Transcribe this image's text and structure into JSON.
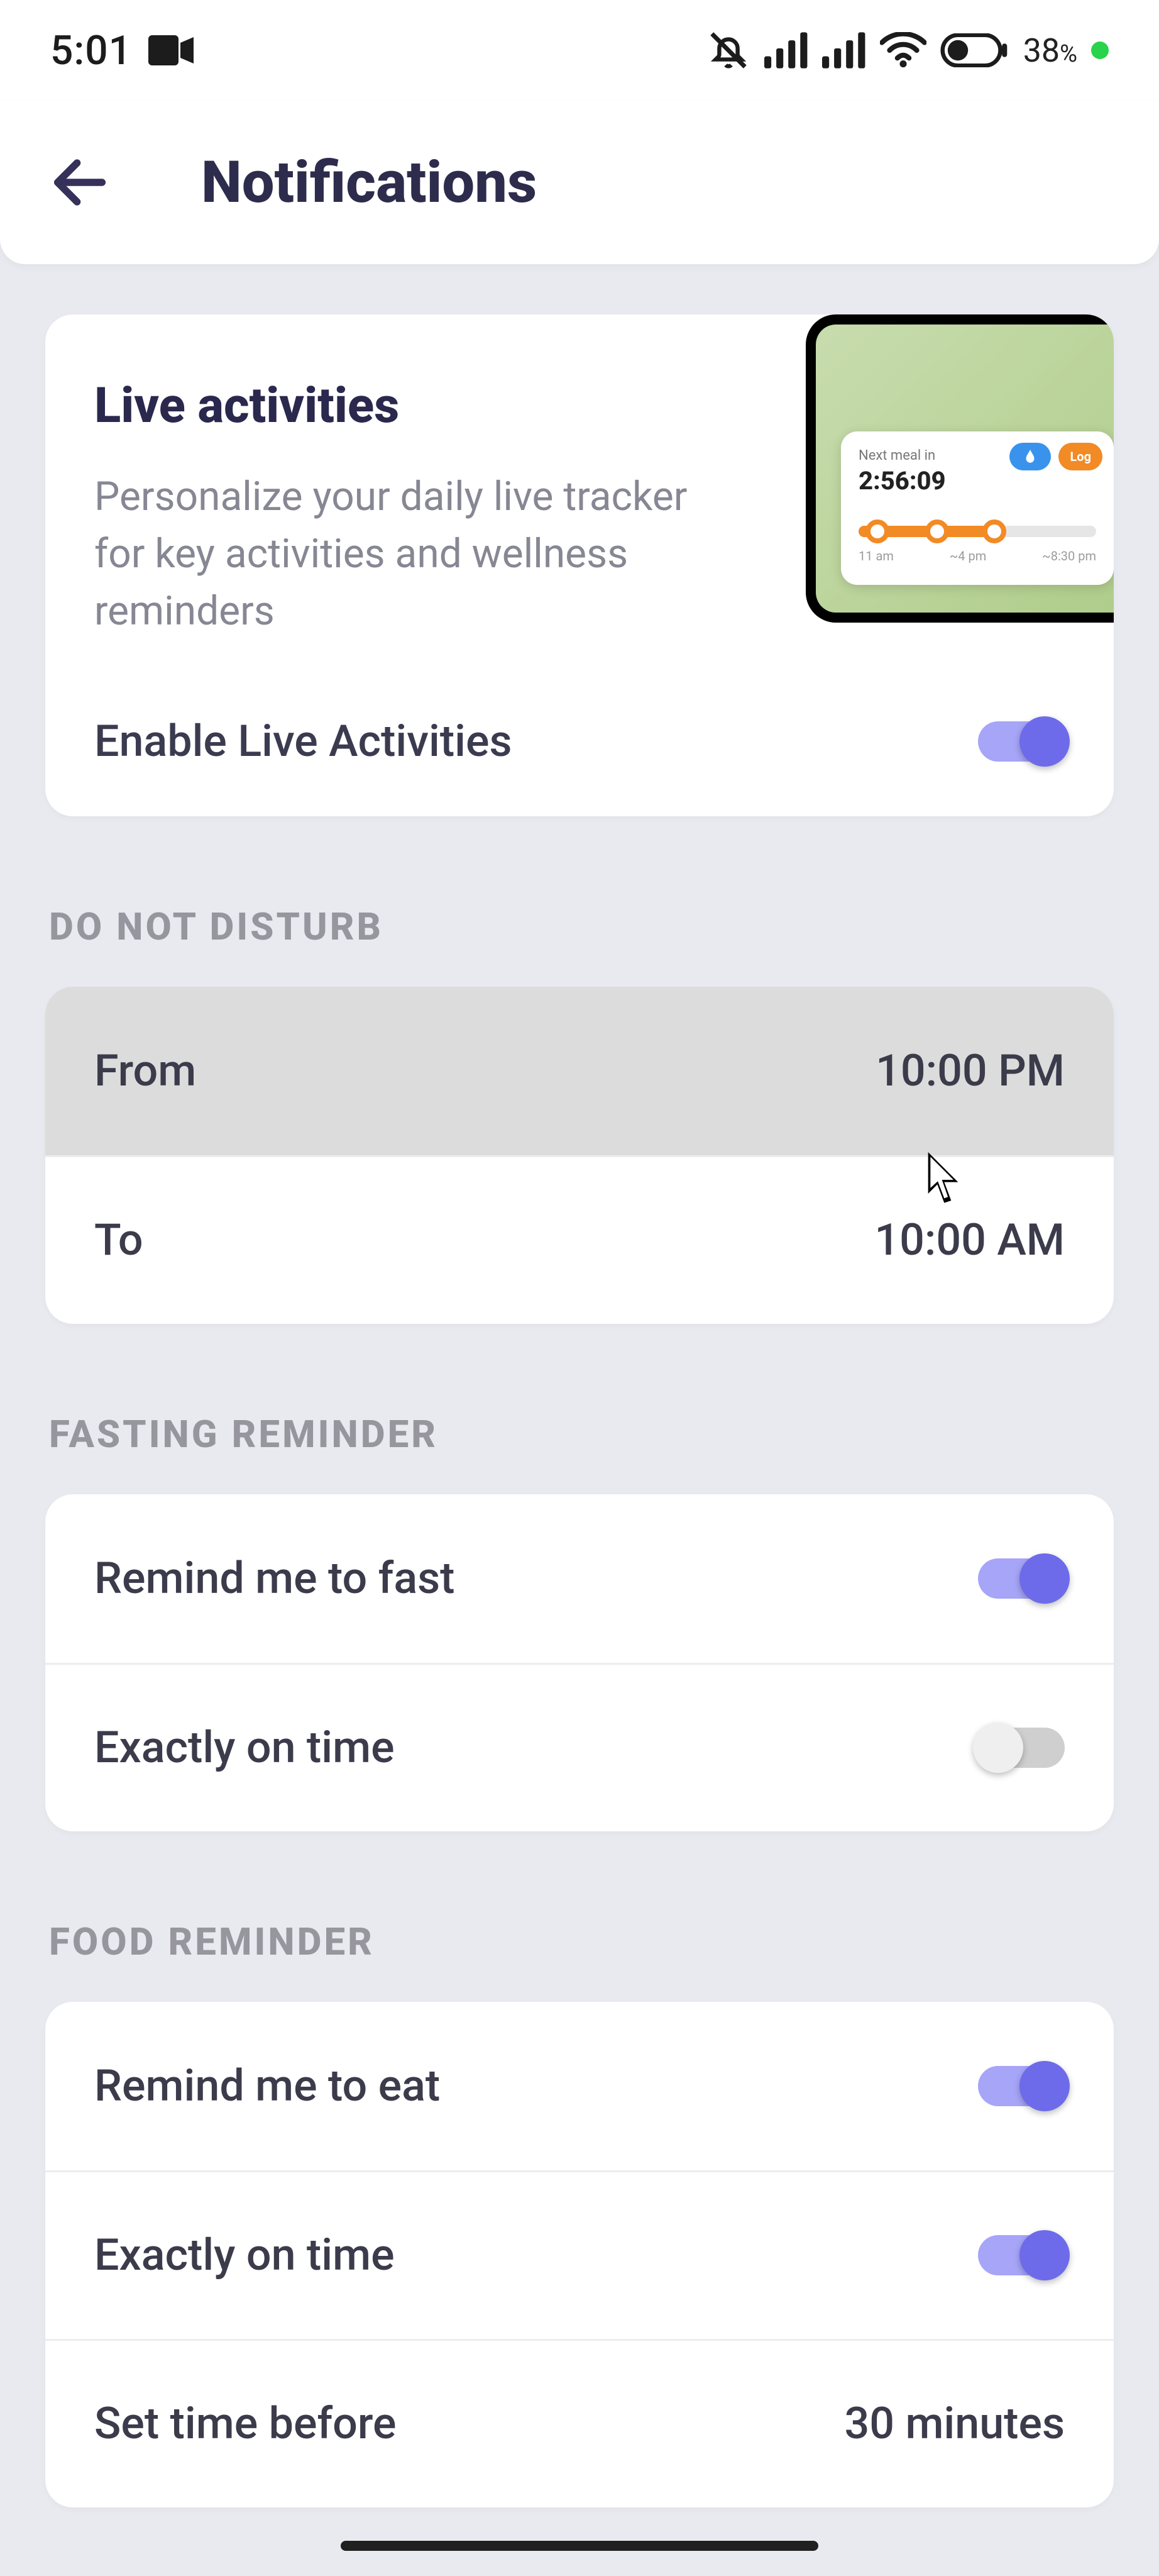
{
  "status_bar": {
    "time": "5:01",
    "battery_pct": "38",
    "pct_symbol": "%"
  },
  "header": {
    "title": "Notifications"
  },
  "live": {
    "title": "Live activities",
    "desc": "Personalize your daily live tracker for key activities and wellness reminders",
    "enable_label": "Enable Live Activities",
    "enabled": true,
    "preview": {
      "next_meal_label": "Next meal in",
      "next_meal_time": "2:56:09",
      "chip_log": "Log",
      "ticks": [
        "11 am",
        "~4 pm",
        "~8:30 pm"
      ]
    }
  },
  "dnd": {
    "header": "DO NOT DISTURB",
    "from_label": "From",
    "from_value": "10:00 PM",
    "to_label": "To",
    "to_value": "10:00 AM"
  },
  "fasting": {
    "header": "FASTING REMINDER",
    "remind_label": "Remind me to fast",
    "remind_on": true,
    "exact_label": "Exactly on time",
    "exact_on": false
  },
  "food": {
    "header": "FOOD REMINDER",
    "remind_label": "Remind me to eat",
    "remind_on": true,
    "exact_label": "Exactly on time",
    "exact_on": true,
    "set_before_label": "Set time before",
    "set_before_value": "30 minutes"
  }
}
